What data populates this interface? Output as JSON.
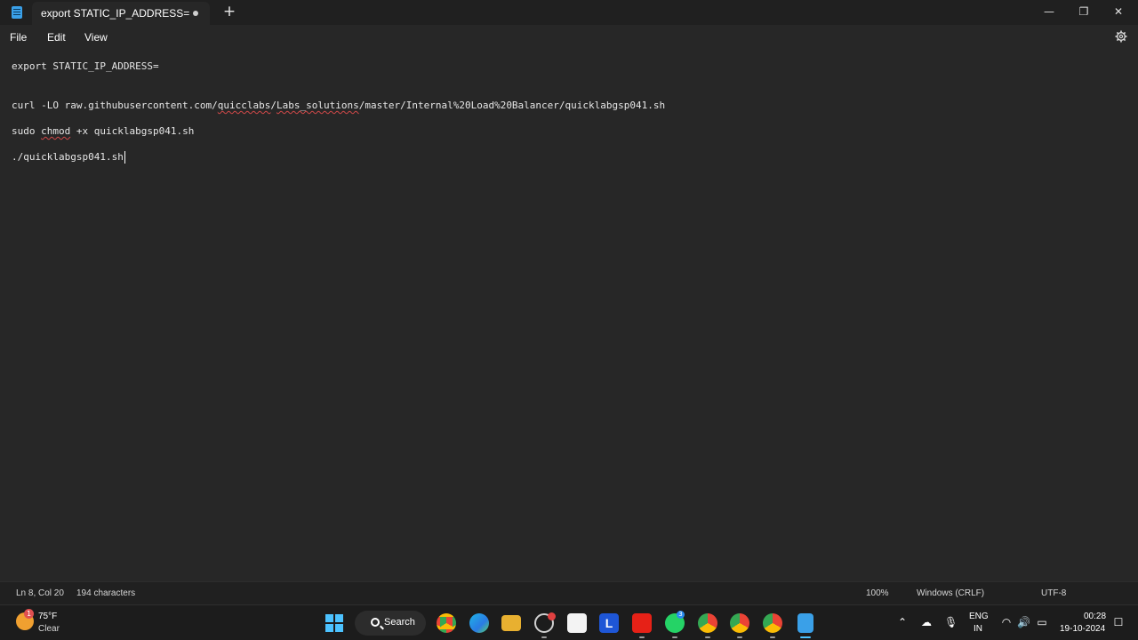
{
  "titlebar": {
    "tab_title": "export STATIC_IP_ADDRESS=",
    "new_tab": "+",
    "minimize": "—",
    "restore": "❐",
    "close": "✕"
  },
  "menu": {
    "file": "File",
    "edit": "Edit",
    "view": "View"
  },
  "editor": {
    "line1": "export STATIC_IP_ADDRESS=",
    "line2_pre": "curl -LO raw.githubusercontent.com/",
    "line2_misspelled1": "quicclabs",
    "line2_mid": "/",
    "line2_misspelled2": "Labs_solutions",
    "line2_post": "/master/Internal%20Load%20Balancer/quicklabgsp041.sh",
    "line3_pre": "sudo ",
    "line3_misspelled": "chmod",
    "line3_post": " +x quicklabgsp041.sh",
    "line4": "./quicklabgsp041.sh"
  },
  "status": {
    "position": "Ln 8, Col 20",
    "characters": "194 characters",
    "zoom": "100%",
    "line_ending": "Windows (CRLF)",
    "encoding": "UTF-8"
  },
  "taskbar": {
    "weather_temp": "75°F",
    "weather_condition": "Clear",
    "weather_badge": "1",
    "search_label": "Search",
    "whatsapp_badge": "3",
    "tray_lang": "ENG",
    "tray_region": "IN",
    "time": "00:28",
    "date": "19-10-2024"
  },
  "colors": {
    "background": "#202020",
    "editor": "#272727",
    "accent": "#4cc2ff",
    "spellcheck": "#d04848"
  }
}
